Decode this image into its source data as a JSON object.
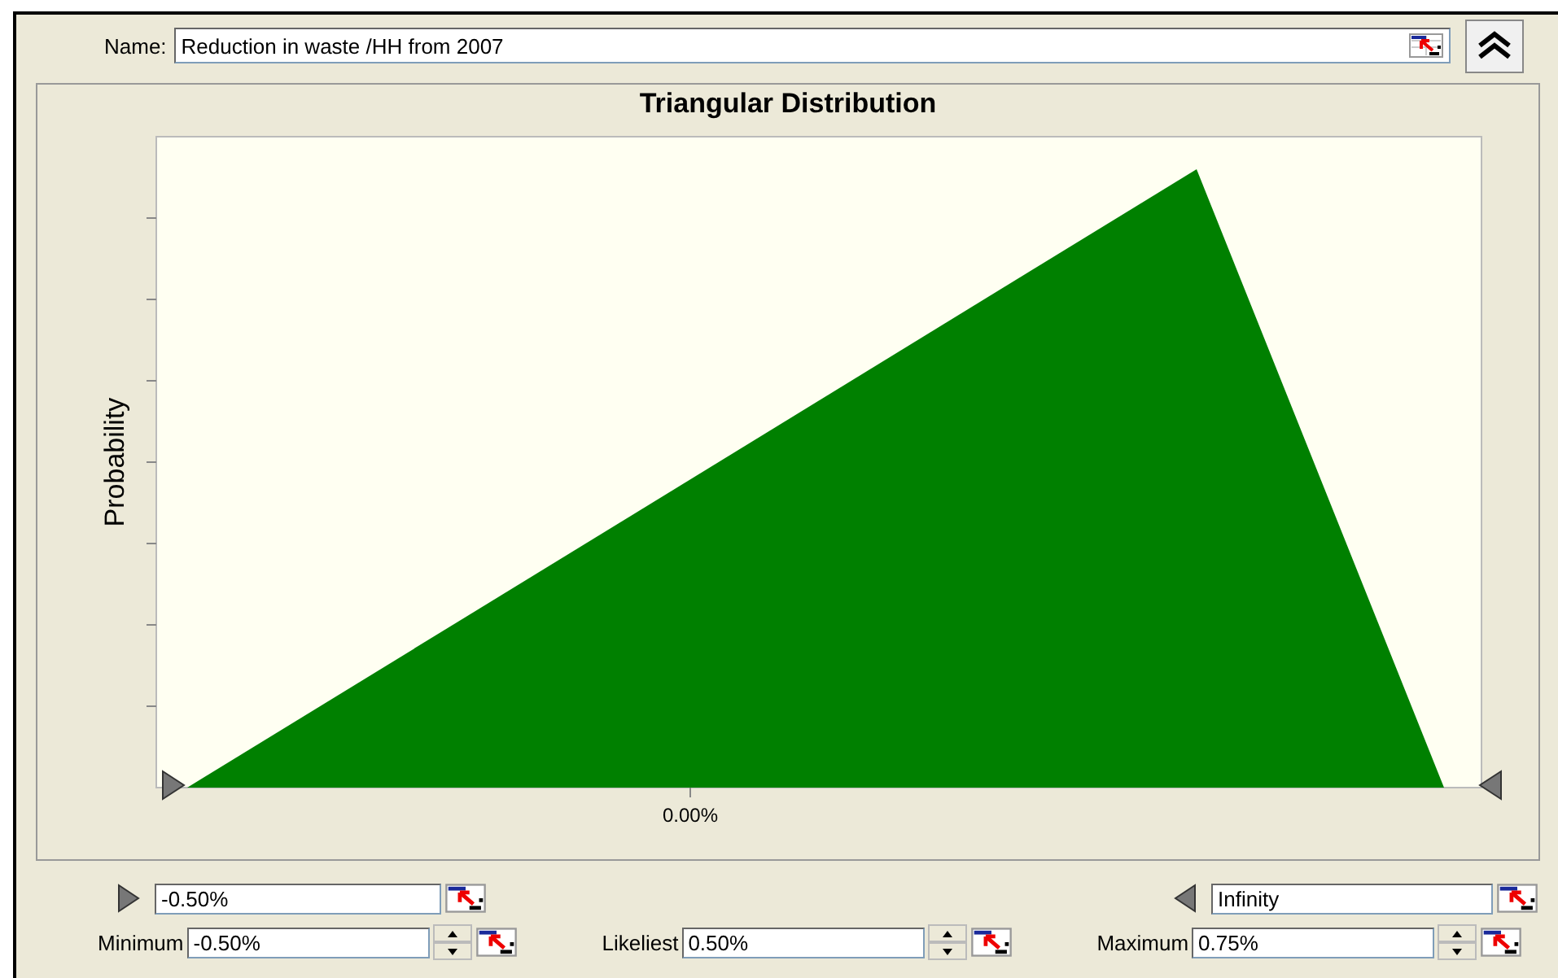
{
  "name_field": {
    "label": "Name:",
    "value": "Reduction in waste /HH from 2007"
  },
  "chart": {
    "title": "Triangular Distribution",
    "ylabel": "Probability",
    "xtick_label": "0.00%"
  },
  "bounds": {
    "lower": {
      "value": "-0.50%"
    },
    "upper": {
      "value": "Infinity"
    }
  },
  "parameters": [
    {
      "label": "Minimum",
      "value": "-0.50%"
    },
    {
      "label": "Likeliest",
      "value": "0.50%"
    },
    {
      "label": "Maximum",
      "value": "0.75%"
    }
  ]
}
